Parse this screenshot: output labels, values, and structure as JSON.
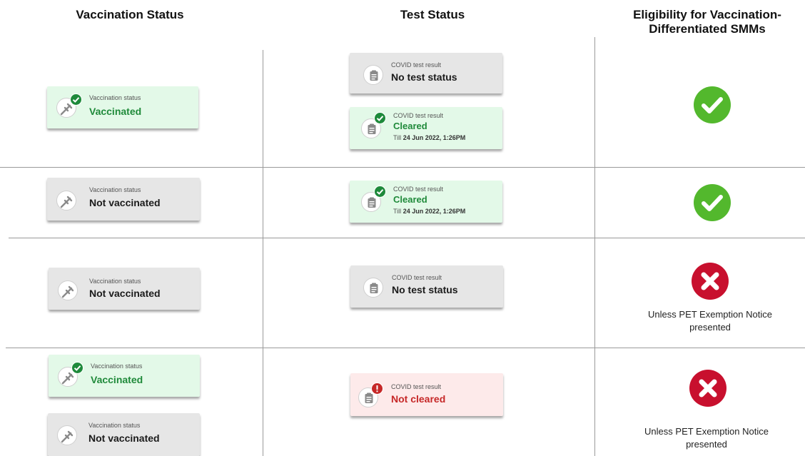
{
  "headers": {
    "vaccination": "Vaccination Status",
    "test": "Test Status",
    "eligibility_line1": "Eligibility for Vaccination-",
    "eligibility_line2": "Differentiated SMMs"
  },
  "card_labels": {
    "vaccination": "Vaccination status",
    "test": "COVID test result"
  },
  "values": {
    "vaccinated": "Vaccinated",
    "not_vaccinated": "Not vaccinated",
    "no_test": "No test status",
    "cleared": "Cleared",
    "not_cleared": "Not cleared",
    "till_prefix": "Till",
    "till_date": "24 Jun 2022, 1:26PM"
  },
  "notes": {
    "exemption_line1": "Unless PET Exemption Notice",
    "exemption_line2": "presented"
  },
  "colors": {
    "green_card": "#e3f9e8",
    "grey_card": "#e6e6e6",
    "pink_card": "#fdeaea",
    "eligible": "#53b82d",
    "not_eligible": "#c8102e",
    "status_green": "#1f8a3a",
    "status_red": "#c62828"
  },
  "icons": {
    "vaccination": "syringe-icon",
    "test": "clipboard-icon",
    "badge_ok": "check-badge-icon",
    "badge_bad": "exclamation-badge-icon",
    "eligible": "check-circle-icon",
    "not_eligible": "x-circle-icon"
  }
}
